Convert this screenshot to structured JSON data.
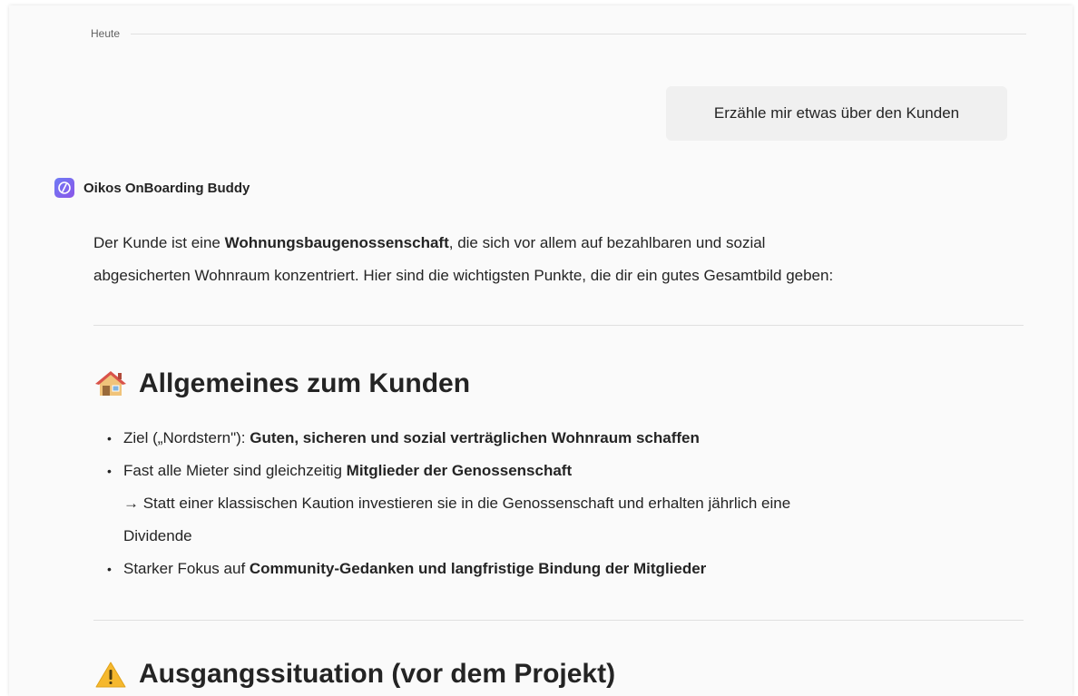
{
  "date_divider": "Heute",
  "user_message": "Erzähle mir etwas über den Kunden",
  "bot": {
    "name": "Oikos OnBoarding Buddy",
    "icon": "slash-circle-icon",
    "avatar_colors": [
      "#6e7cf5",
      "#8a55e8"
    ]
  },
  "intro": {
    "p1_a": "Der Kunde ist eine ",
    "p1_b": "Wohnungsbaugenossenschaft",
    "p1_c": ", die sich vor allem auf bezahlbaren und sozial",
    "p2": "abgesicherten Wohnraum konzentriert. Hier sind die wichtigsten Punkte, die dir ein gutes Gesamtbild geben:"
  },
  "section1": {
    "icon": "house-icon",
    "title": "Allgemeines zum Kunden",
    "bullets": [
      {
        "text": "Ziel („Nordstern\"): ",
        "bold": "Guten, sicheren und sozial verträglichen Wohnraum schaffen"
      },
      {
        "text": "Fast alle Mieter sind gleichzeitig ",
        "bold": "Mitglieder der Genossenschaft",
        "sub1": "→ Statt einer klassischen Kaution investieren sie in die Genossenschaft und erhalten jährlich eine",
        "sub2": "Dividende"
      },
      {
        "text": "Starker Fokus auf ",
        "bold": "Community-Gedanken und langfristige Bindung der Mitglieder"
      }
    ]
  },
  "section2": {
    "icon": "warning-icon",
    "title": "Ausgangssituation (vor dem Projekt)"
  }
}
